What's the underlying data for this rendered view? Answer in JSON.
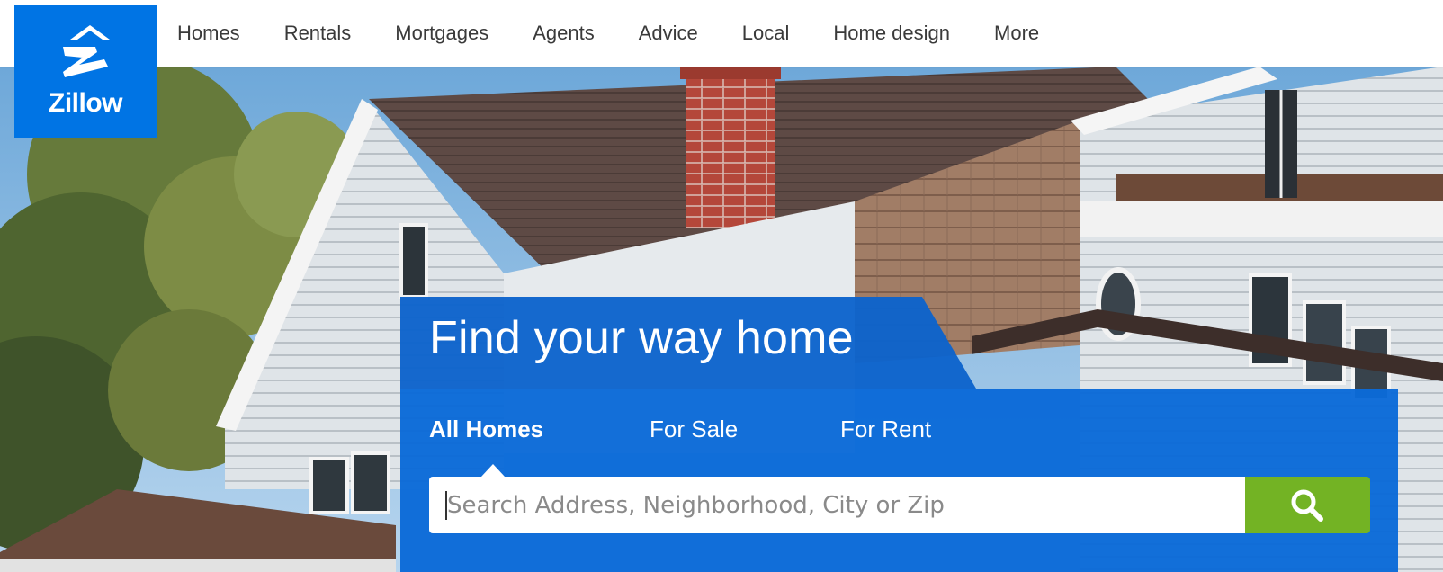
{
  "brand": {
    "name": "Zillow",
    "color": "#0074e4",
    "icon": "zillow-z-logo-icon"
  },
  "nav": {
    "items": [
      {
        "label": "Homes"
      },
      {
        "label": "Rentals"
      },
      {
        "label": "Mortgages"
      },
      {
        "label": "Agents"
      },
      {
        "label": "Advice"
      },
      {
        "label": "Local"
      },
      {
        "label": "Home design"
      },
      {
        "label": "More"
      }
    ]
  },
  "hero": {
    "headline": "Find your way home",
    "tabs": [
      {
        "label": "All Homes",
        "active": true
      },
      {
        "label": "For Sale",
        "active": false
      },
      {
        "label": "For Rent",
        "active": false
      }
    ],
    "search": {
      "placeholder": "Search Address, Neighborhood, City or Zip",
      "value": "",
      "button_icon": "search-icon",
      "button_color": "#73b324"
    },
    "panel_color": "#0b6ad8"
  }
}
